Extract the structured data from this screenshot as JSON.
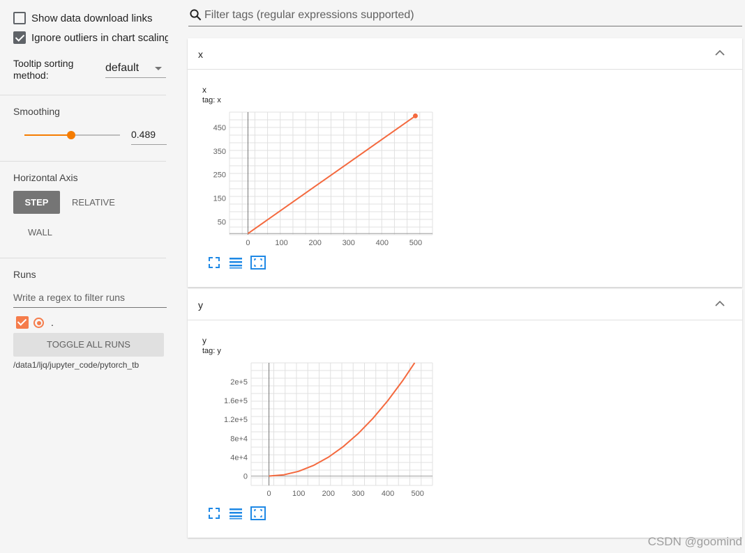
{
  "sidebar": {
    "show_download_links": {
      "label": "Show data download links",
      "checked": false
    },
    "ignore_outliers": {
      "label": "Ignore outliers in chart scaling",
      "checked": true
    },
    "tooltip_sorting": {
      "label": "Tooltip sorting method:",
      "value": "default"
    },
    "smoothing": {
      "title": "Smoothing",
      "value": "0.489"
    },
    "horizontal_axis": {
      "title": "Horizontal Axis",
      "options": [
        "STEP",
        "RELATIVE",
        "WALL"
      ],
      "selected": "STEP"
    },
    "runs": {
      "title": "Runs",
      "filter_placeholder": "Write a regex to filter runs",
      "items": [
        {
          "name": ".",
          "color": "#f57c4b",
          "checked": true
        }
      ],
      "toggle_all_label": "TOGGLE ALL RUNS",
      "log_dir": "/data1/ljq/jupyter_code/pytorch_tb"
    }
  },
  "main": {
    "filter_placeholder": "Filter tags (regular expressions supported)",
    "cards": [
      {
        "header": "x",
        "chart_title": "x",
        "chart_tag": "tag: x"
      },
      {
        "header": "y",
        "chart_title": "y",
        "chart_tag": "tag: y"
      }
    ]
  },
  "colors": {
    "accent": "#f57c00",
    "series": "#f4693e"
  },
  "icons": [
    "search-icon",
    "chevron-up-icon",
    "fullscreen-icon",
    "list-icon",
    "fit-domain-icon"
  ],
  "watermark": "CSDN @goomind",
  "chart_data": [
    {
      "type": "line",
      "title": "x",
      "subtitle": "tag: x",
      "x_ticks": [
        "0",
        "100",
        "200",
        "300",
        "400",
        "500"
      ],
      "y_ticks": [
        "50",
        "150",
        "250",
        "350",
        "450"
      ],
      "xlim": [
        -55,
        550
      ],
      "ylim": [
        -5,
        515
      ],
      "series": [
        {
          "x": [
            0,
            100,
            200,
            300,
            400,
            499
          ],
          "y": [
            0,
            100,
            200,
            300,
            400,
            499
          ]
        }
      ],
      "grid": true
    },
    {
      "type": "line",
      "title": "y",
      "subtitle": "tag: y",
      "x_ticks": [
        "0",
        "100",
        "200",
        "300",
        "400",
        "500"
      ],
      "y_ticks": [
        "0",
        "4e+4",
        "8e+4",
        "1.2e+5",
        "1.6e+5",
        "2e+5"
      ],
      "y_tick_values": [
        0,
        40000,
        80000,
        120000,
        160000,
        200000
      ],
      "xlim": [
        -60,
        550
      ],
      "ylim": [
        -20000,
        240000
      ],
      "series": [
        {
          "x": [
            0,
            50,
            100,
            150,
            200,
            250,
            300,
            350,
            400,
            450,
            490
          ],
          "y": [
            0,
            2500,
            10000,
            22500,
            40000,
            62500,
            90000,
            122500,
            160000,
            202500,
            240100
          ]
        }
      ],
      "grid": true
    }
  ]
}
